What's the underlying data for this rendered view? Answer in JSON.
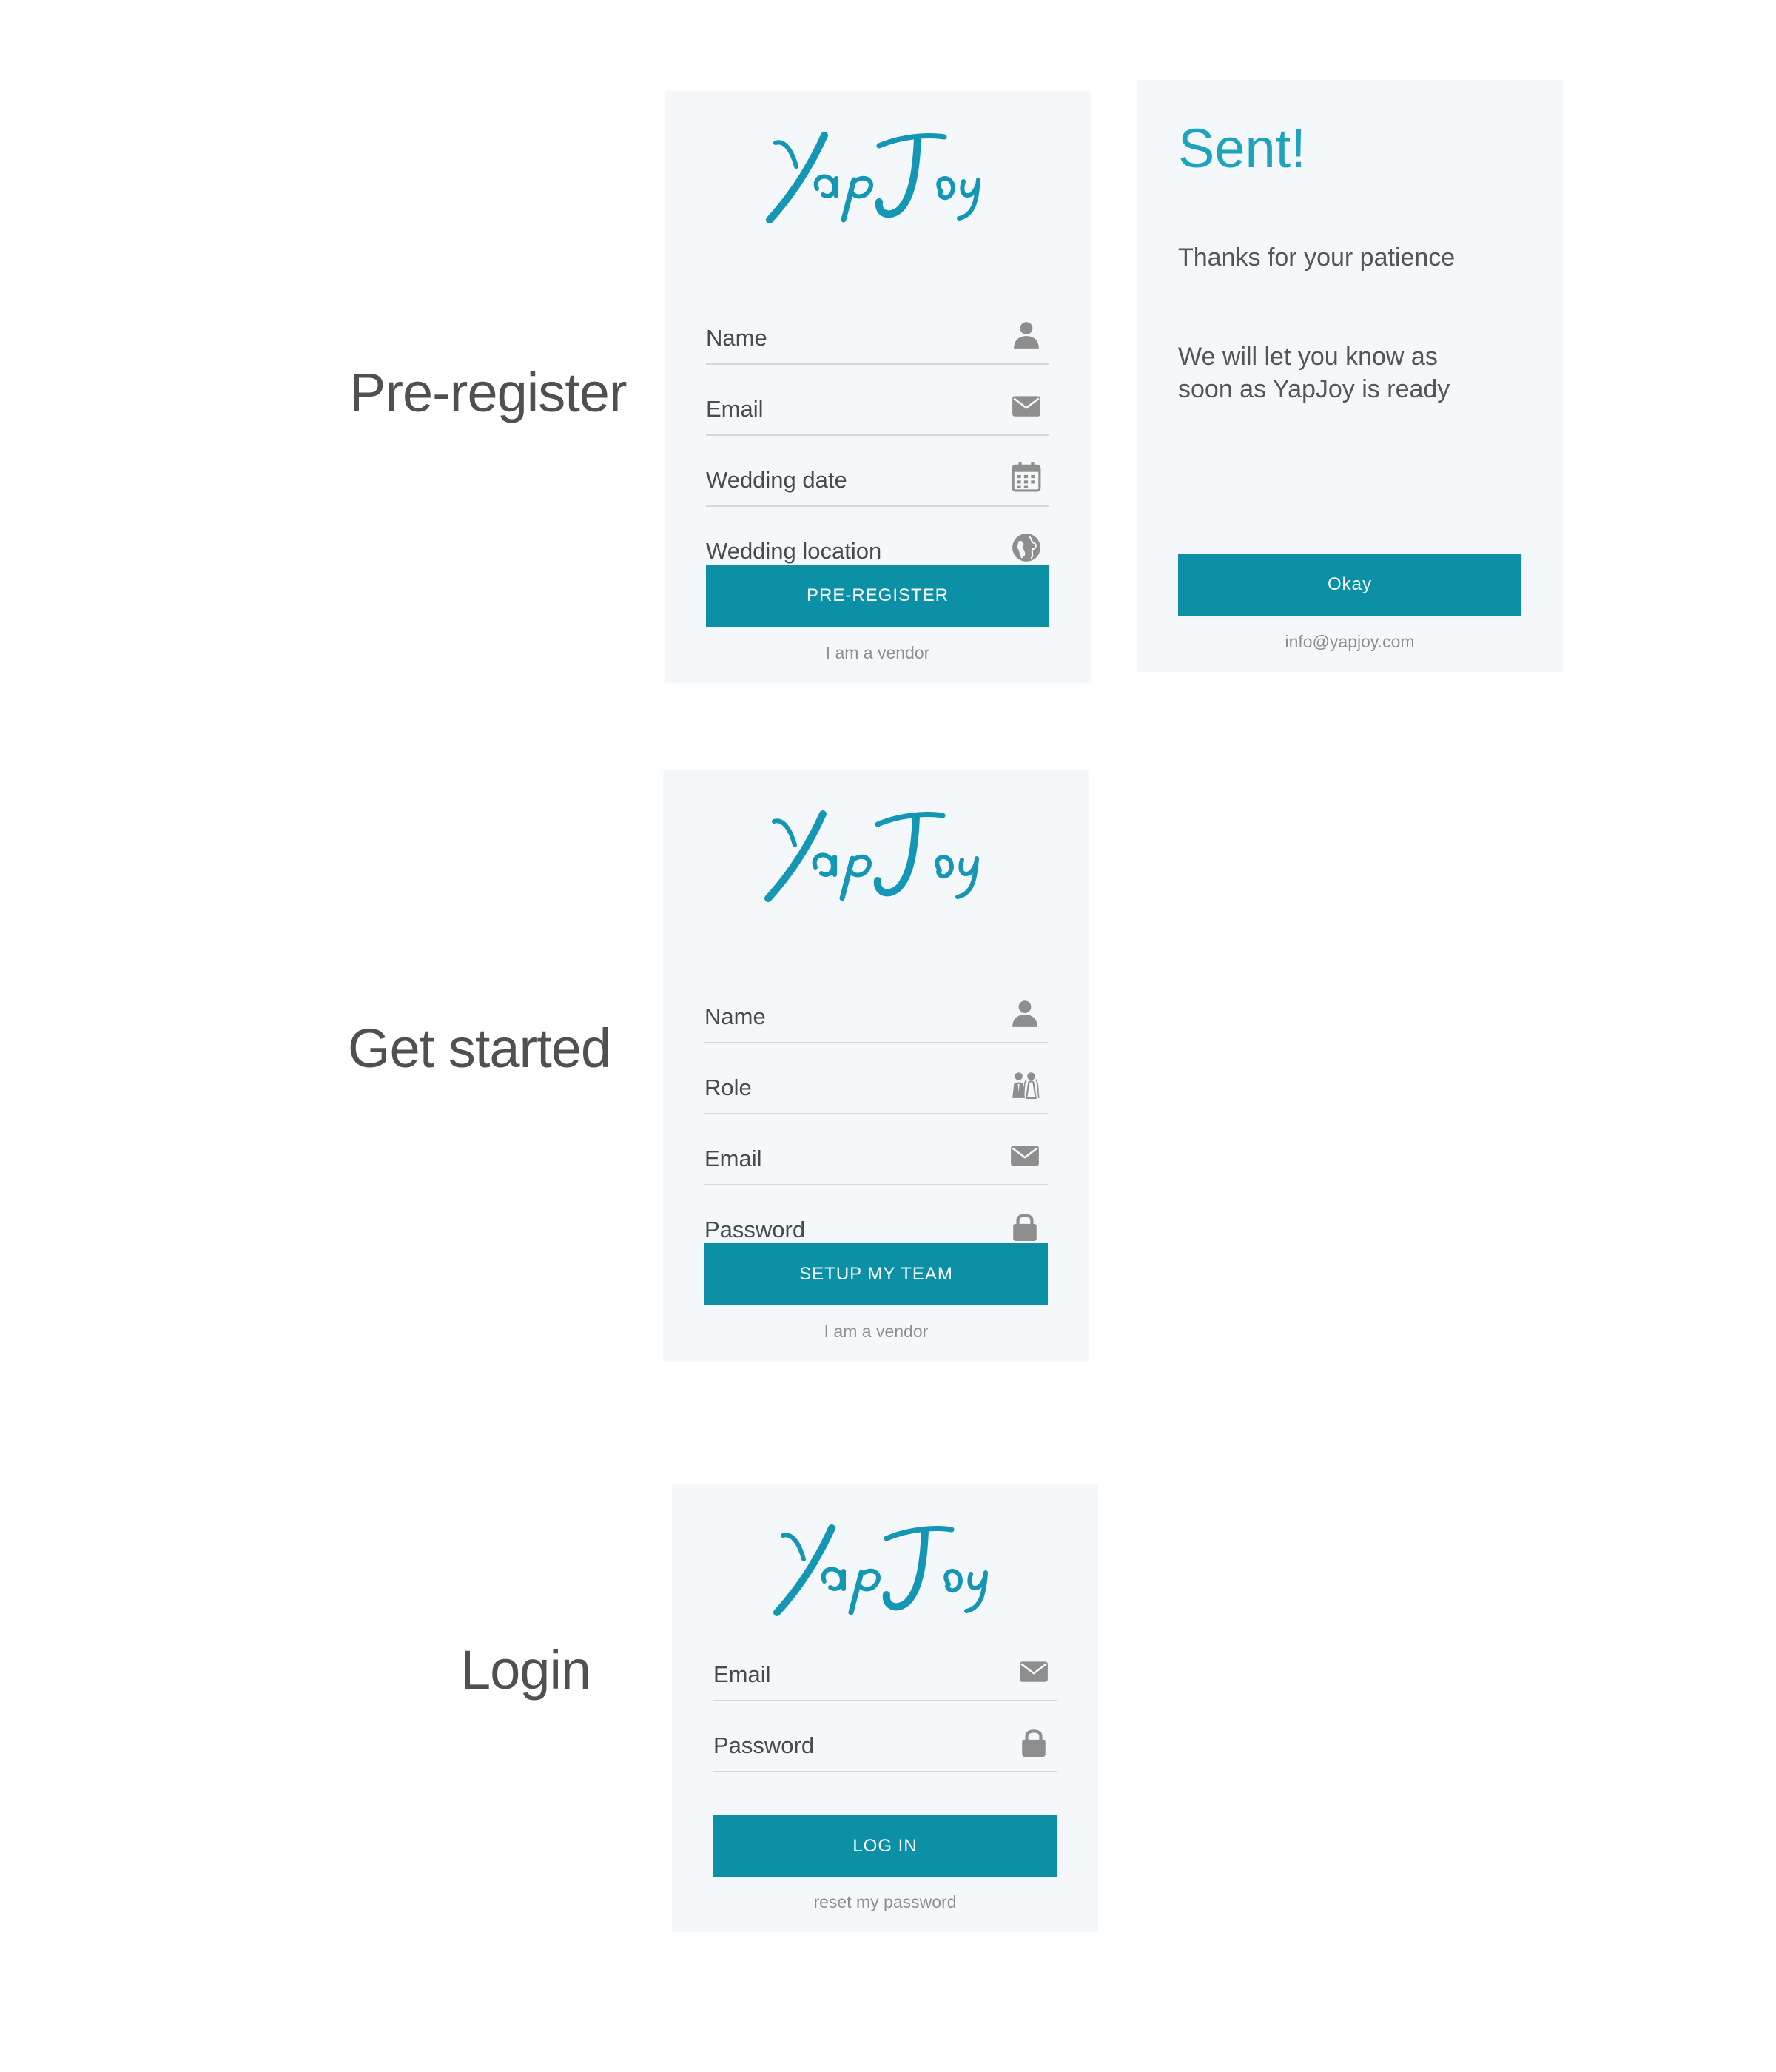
{
  "brand": {
    "logo_text": "YapJoy",
    "accent_color": "#0b90a6",
    "logo_color": "#1496b5"
  },
  "preregister": {
    "section_label": "Pre-register",
    "fields": [
      {
        "label": "Name",
        "icon": "user-icon"
      },
      {
        "label": "Email",
        "icon": "envelope-icon"
      },
      {
        "label": "Wedding date",
        "icon": "calendar-icon"
      },
      {
        "label": "Wedding location",
        "icon": "globe-icon"
      }
    ],
    "button_label": "PRE-REGISTER",
    "sublink": "I am a vendor"
  },
  "sent": {
    "title": "Sent!",
    "message_1": "Thanks for your patience",
    "message_2": "We will let you know as soon as YapJoy is ready",
    "button_label": "Okay",
    "email": "info@yapjoy.com"
  },
  "get_started": {
    "section_label": "Get started",
    "fields": [
      {
        "label": "Name",
        "icon": "user-icon"
      },
      {
        "label": "Role",
        "icon": "couple-icon"
      },
      {
        "label": "Email",
        "icon": "envelope-icon"
      },
      {
        "label": "Password",
        "icon": "lock-icon"
      }
    ],
    "button_label": "SETUP MY TEAM",
    "sublink": "I am a vendor"
  },
  "login": {
    "section_label": "Login",
    "fields": [
      {
        "label": "Email",
        "icon": "envelope-icon"
      },
      {
        "label": "Password",
        "icon": "lock-icon"
      }
    ],
    "button_label": "LOG IN",
    "sublink": "reset my password"
  }
}
